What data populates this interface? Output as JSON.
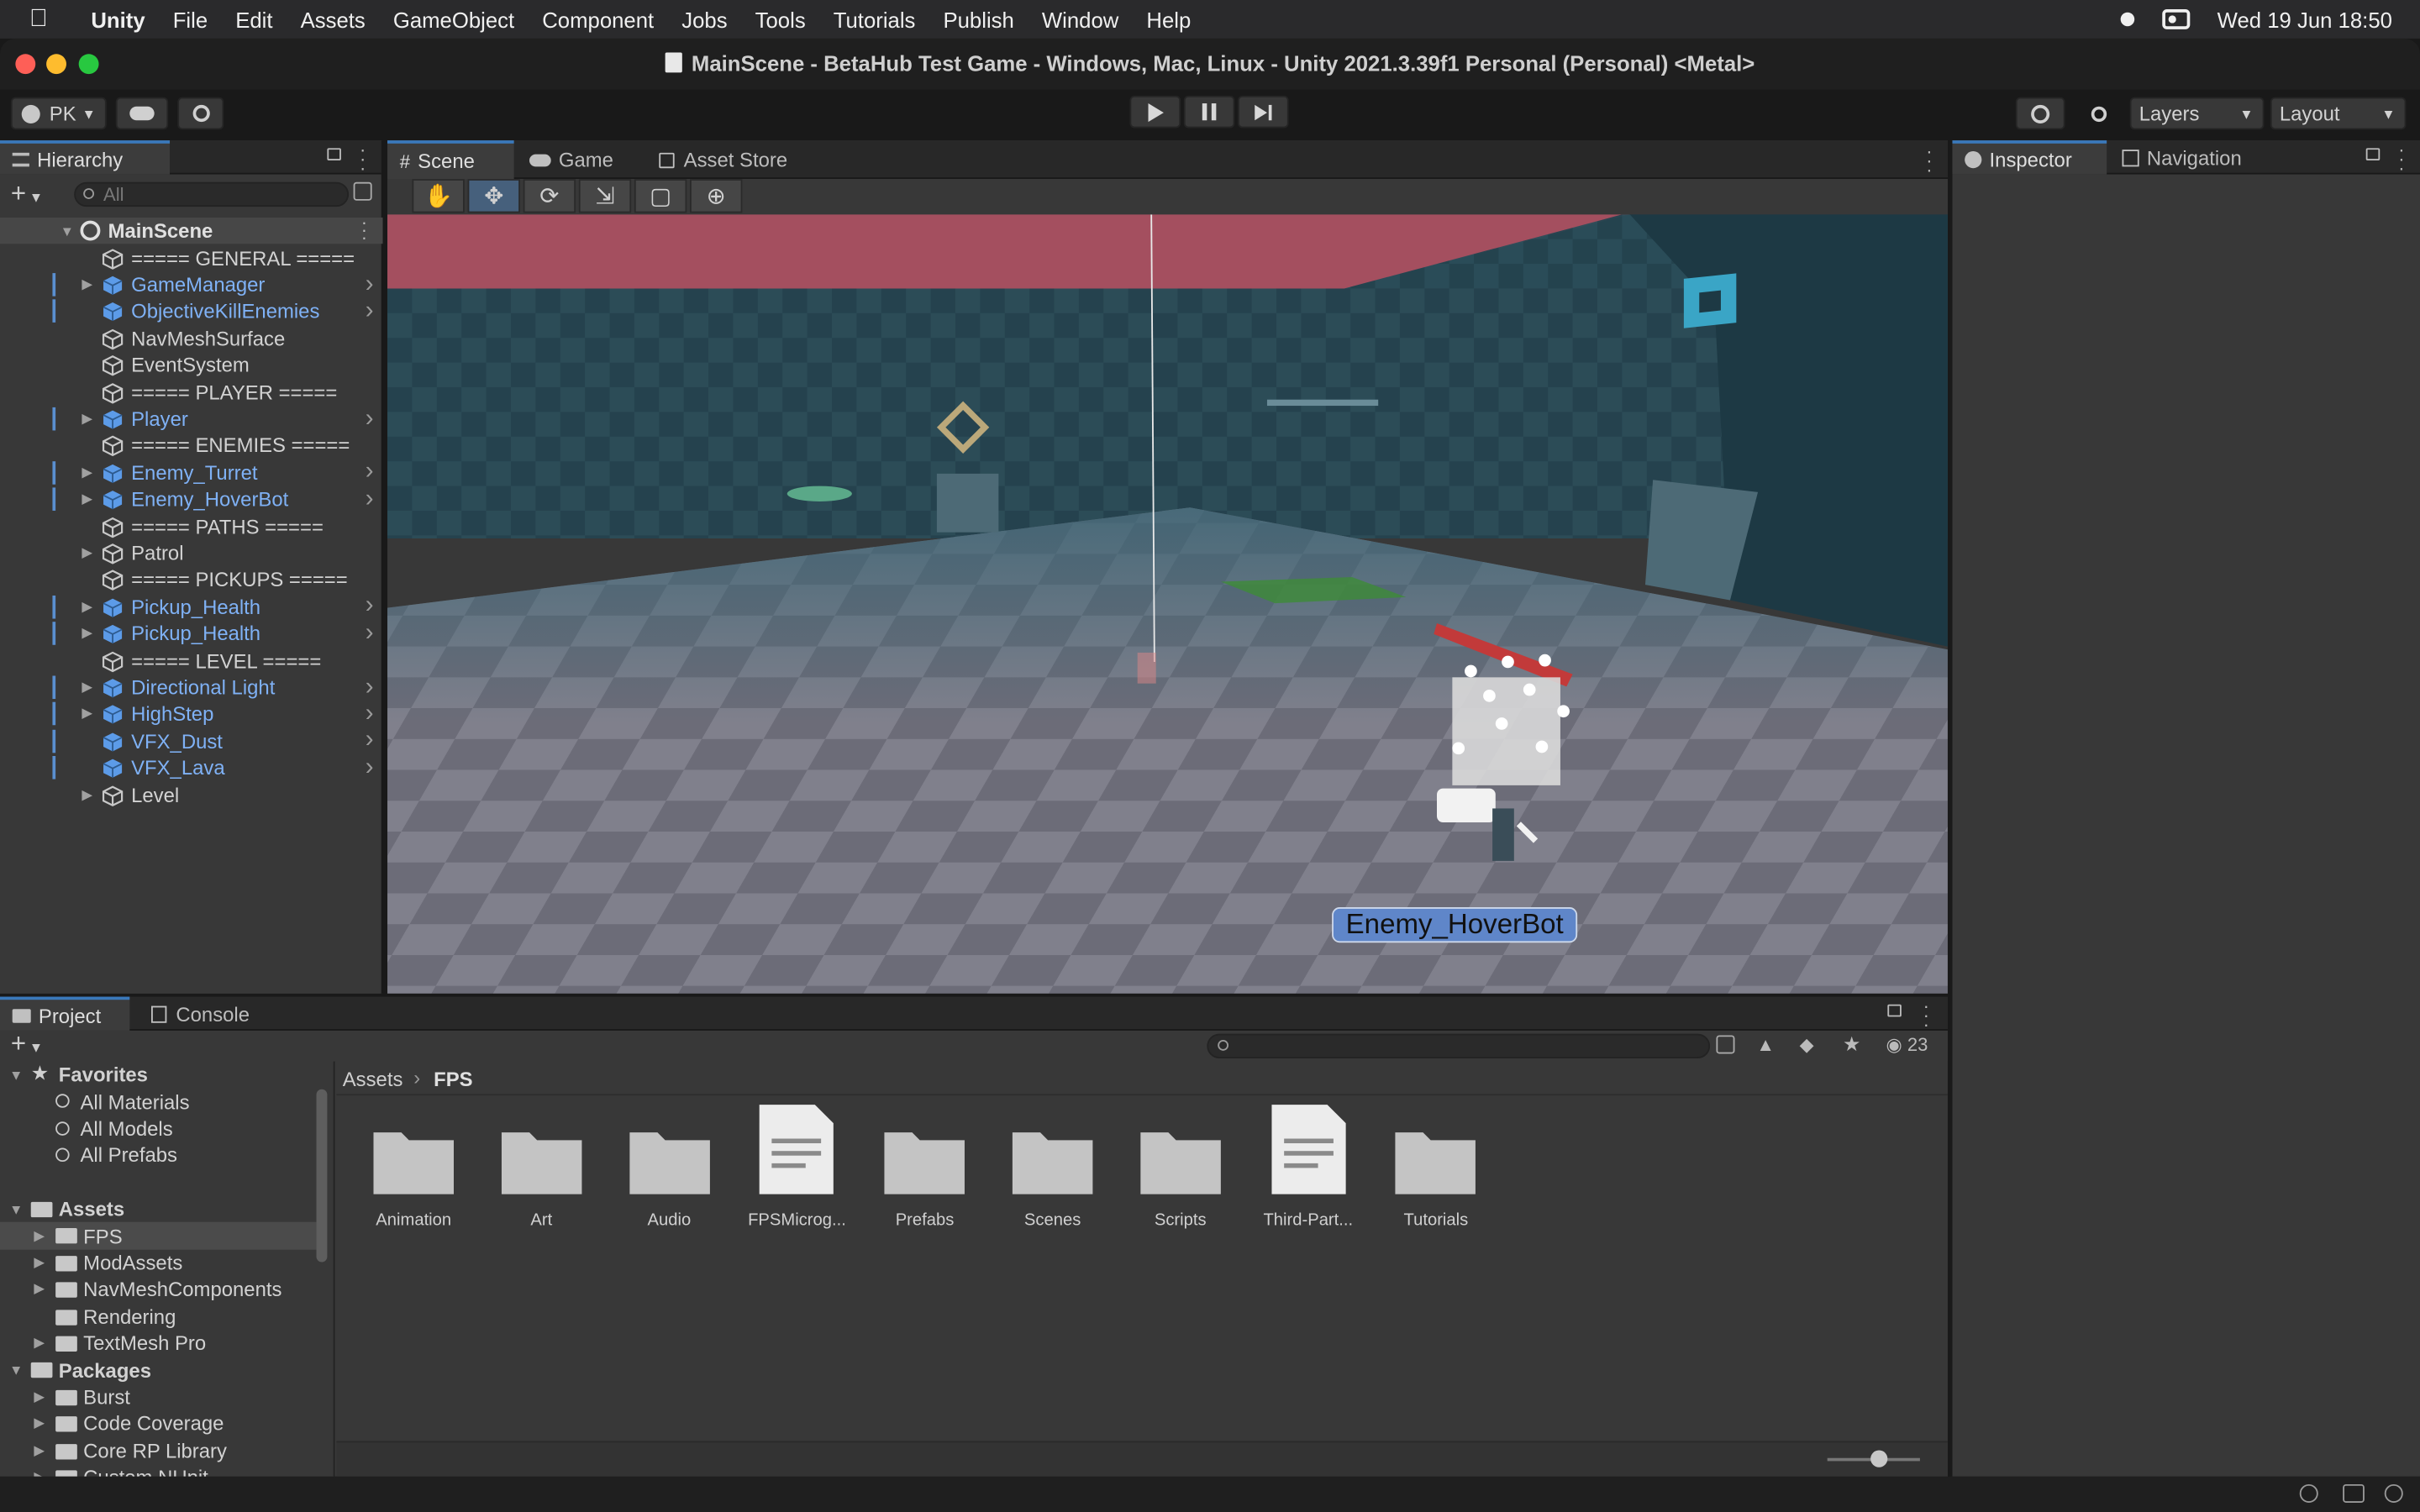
{
  "menubar": {
    "app_name": "Unity",
    "items": [
      "File",
      "Edit",
      "Assets",
      "GameObject",
      "Component",
      "Jobs",
      "Tools",
      "Tutorials",
      "Publish",
      "Window",
      "Help"
    ],
    "clock": "Wed 19 Jun  18:50"
  },
  "window": {
    "title": "MainScene - BetaHub Test Game - Windows, Mac, Linux - Unity 2021.3.39f1 Personal (Personal) <Metal>"
  },
  "toolbar": {
    "account": "PK",
    "layers_label": "Layers",
    "layout_label": "Layout"
  },
  "hierarchy": {
    "tab_label": "Hierarchy",
    "search_placeholder": "All",
    "scene_name": "MainScene",
    "items": [
      {
        "label": "===== GENERAL =====",
        "prefab": false,
        "expandable": false,
        "chevron": false,
        "marked": false
      },
      {
        "label": "GameManager",
        "prefab": true,
        "expandable": true,
        "chevron": true,
        "marked": true
      },
      {
        "label": "ObjectiveKillEnemies",
        "prefab": true,
        "expandable": false,
        "chevron": true,
        "marked": true
      },
      {
        "label": "NavMeshSurface",
        "prefab": false,
        "expandable": false,
        "chevron": false,
        "marked": false
      },
      {
        "label": "EventSystem",
        "prefab": false,
        "expandable": false,
        "chevron": false,
        "marked": false
      },
      {
        "label": "===== PLAYER =====",
        "prefab": false,
        "expandable": false,
        "chevron": false,
        "marked": false
      },
      {
        "label": "Player",
        "prefab": true,
        "expandable": true,
        "chevron": true,
        "marked": true
      },
      {
        "label": "===== ENEMIES =====",
        "prefab": false,
        "expandable": false,
        "chevron": false,
        "marked": false
      },
      {
        "label": "Enemy_Turret",
        "prefab": true,
        "expandable": true,
        "chevron": true,
        "marked": true
      },
      {
        "label": "Enemy_HoverBot",
        "prefab": true,
        "expandable": true,
        "chevron": true,
        "marked": true
      },
      {
        "label": "===== PATHS =====",
        "prefab": false,
        "expandable": false,
        "chevron": false,
        "marked": false
      },
      {
        "label": "Patrol",
        "prefab": false,
        "expandable": true,
        "chevron": false,
        "marked": false
      },
      {
        "label": "===== PICKUPS =====",
        "prefab": false,
        "expandable": false,
        "chevron": false,
        "marked": false
      },
      {
        "label": "Pickup_Health",
        "prefab": true,
        "expandable": true,
        "chevron": true,
        "marked": true
      },
      {
        "label": "Pickup_Health",
        "prefab": true,
        "expandable": true,
        "chevron": true,
        "marked": true
      },
      {
        "label": "===== LEVEL =====",
        "prefab": false,
        "expandable": false,
        "chevron": false,
        "marked": false
      },
      {
        "label": "Directional Light",
        "prefab": true,
        "expandable": true,
        "chevron": true,
        "marked": true
      },
      {
        "label": "HighStep",
        "prefab": true,
        "expandable": true,
        "chevron": true,
        "marked": true
      },
      {
        "label": "VFX_Dust",
        "prefab": true,
        "expandable": false,
        "chevron": true,
        "marked": true
      },
      {
        "label": "VFX_Lava",
        "prefab": true,
        "expandable": false,
        "chevron": true,
        "marked": true
      },
      {
        "label": "Level",
        "prefab": false,
        "expandable": true,
        "chevron": false,
        "marked": false
      }
    ]
  },
  "scene": {
    "tabs": [
      "Scene",
      "Game",
      "Asset Store"
    ],
    "selected_object_label": "Enemy_HoverBot"
  },
  "inspector": {
    "tabs": [
      "Inspector",
      "Navigation"
    ]
  },
  "project": {
    "tabs": [
      "Project",
      "Console"
    ],
    "breadcrumb": [
      "Assets",
      "FPS"
    ],
    "hidden_count": "23",
    "tree": [
      {
        "label": "Favorites",
        "kind": "header",
        "indent": 0,
        "arrow": true
      },
      {
        "label": "All Materials",
        "kind": "search",
        "indent": 1,
        "arrow": false
      },
      {
        "label": "All Models",
        "kind": "search",
        "indent": 1,
        "arrow": false
      },
      {
        "label": "All Prefabs",
        "kind": "search",
        "indent": 1,
        "arrow": false
      },
      {
        "label": "",
        "kind": "spacer",
        "indent": 0,
        "arrow": false
      },
      {
        "label": "Assets",
        "kind": "header-folder",
        "indent": 0,
        "arrow": true
      },
      {
        "label": "FPS",
        "kind": "folder",
        "indent": 1,
        "arrow": true,
        "selected": true
      },
      {
        "label": "ModAssets",
        "kind": "folder",
        "indent": 1,
        "arrow": true
      },
      {
        "label": "NavMeshComponents",
        "kind": "folder",
        "indent": 1,
        "arrow": true
      },
      {
        "label": "Rendering",
        "kind": "folder",
        "indent": 1,
        "arrow": false
      },
      {
        "label": "TextMesh Pro",
        "kind": "folder",
        "indent": 1,
        "arrow": true
      },
      {
        "label": "Packages",
        "kind": "header-folder",
        "indent": 0,
        "arrow": true
      },
      {
        "label": "Burst",
        "kind": "folder",
        "indent": 1,
        "arrow": true
      },
      {
        "label": "Code Coverage",
        "kind": "folder",
        "indent": 1,
        "arrow": true
      },
      {
        "label": "Core RP Library",
        "kind": "folder",
        "indent": 1,
        "arrow": true
      },
      {
        "label": "Custom NUnit",
        "kind": "folder",
        "indent": 1,
        "arrow": true
      }
    ],
    "assets": [
      {
        "label": "Animation",
        "type": "folder"
      },
      {
        "label": "Art",
        "type": "folder"
      },
      {
        "label": "Audio",
        "type": "folder"
      },
      {
        "label": "FPSMicrog...",
        "type": "file"
      },
      {
        "label": "Prefabs",
        "type": "folder"
      },
      {
        "label": "Scenes",
        "type": "folder"
      },
      {
        "label": "Scripts",
        "type": "folder"
      },
      {
        "label": "Third-Part...",
        "type": "file"
      },
      {
        "label": "Tutorials",
        "type": "folder"
      }
    ]
  },
  "colors": {
    "accent": "#3a79bb",
    "prefab_text": "#7fb1f5",
    "panel_bg": "#383838",
    "tab_bar_bg": "#282828"
  }
}
